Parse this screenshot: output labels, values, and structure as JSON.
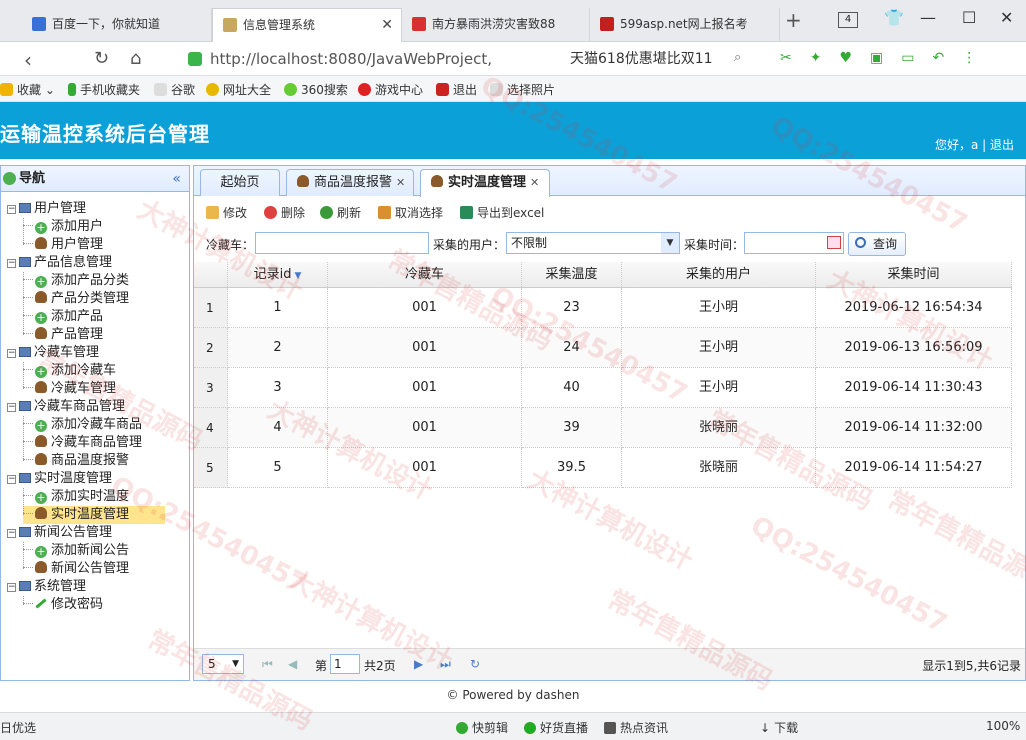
{
  "browser": {
    "tabs": [
      {
        "title": "百度一下，你就知道",
        "active": false
      },
      {
        "title": "信息管理系统",
        "active": true
      },
      {
        "title": "南方暴雨洪涝灾害致88",
        "active": false
      },
      {
        "title": "599asp.net网上报名考",
        "active": false
      }
    ],
    "tab_count": "4",
    "url": "http://localhost:8080/JavaWebProject,",
    "search_text": "天猫618优惠堪比双11",
    "bookmarks": [
      "收藏",
      "手机收藏夹",
      "谷歌",
      "网址大全",
      "360搜索",
      "游戏中心",
      "退出",
      "选择照片"
    ]
  },
  "app": {
    "title": "运输温控系统后台管理",
    "welcome": "您好，a",
    "logout": "退出"
  },
  "nav": {
    "title": "导航",
    "groups": [
      {
        "label": "用户管理",
        "items": [
          "添加用户",
          "用户管理"
        ]
      },
      {
        "label": "产品信息管理",
        "items": [
          "添加产品分类",
          "产品分类管理",
          "添加产品",
          "产品管理"
        ]
      },
      {
        "label": "冷藏车管理",
        "items": [
          "添加冷藏车",
          "冷藏车管理"
        ]
      },
      {
        "label": "冷藏车商品管理",
        "items": [
          "添加冷藏车商品",
          "冷藏车商品管理",
          "商品温度报警"
        ]
      },
      {
        "label": "实时温度管理",
        "items": [
          "添加实时温度",
          "实时温度管理"
        ]
      },
      {
        "label": "新闻公告管理",
        "items": [
          "添加新闻公告",
          "新闻公告管理"
        ]
      },
      {
        "label": "系统管理",
        "items": [
          "修改密码"
        ]
      }
    ],
    "selected": "实时温度管理"
  },
  "content_tabs": [
    {
      "label": "起始页",
      "closable": false
    },
    {
      "label": "商品温度报警",
      "closable": true
    },
    {
      "label": "实时温度管理",
      "closable": true,
      "active": true
    }
  ],
  "toolbar": {
    "edit": "修改",
    "delete": "删除",
    "refresh": "刷新",
    "cancel_select": "取消选择",
    "export": "导出到excel"
  },
  "filter": {
    "truck_label": "冷藏车：",
    "truck_value": "",
    "user_label": "采集的用户：",
    "user_value": "不限制",
    "time_label": "采集时间：",
    "time_value": "",
    "query": "查询"
  },
  "table": {
    "headers": [
      "记录id",
      "冷藏车",
      "采集温度",
      "采集的用户",
      "采集时间"
    ],
    "rows": [
      {
        "rn": "1",
        "id": "1",
        "truck": "001",
        "temp": "23",
        "user": "王小明",
        "time": "2019-06-12 16:54:34"
      },
      {
        "rn": "2",
        "id": "2",
        "truck": "001",
        "temp": "24",
        "user": "王小明",
        "time": "2019-06-13 16:56:09"
      },
      {
        "rn": "3",
        "id": "3",
        "truck": "001",
        "temp": "40",
        "user": "王小明",
        "time": "2019-06-14 11:30:43"
      },
      {
        "rn": "4",
        "id": "4",
        "truck": "001",
        "temp": "39",
        "user": "张晓丽",
        "time": "2019-06-14 11:32:00"
      },
      {
        "rn": "5",
        "id": "5",
        "truck": "001",
        "temp": "39.5",
        "user": "张晓丽",
        "time": "2019-06-14 11:54:27"
      }
    ]
  },
  "pager": {
    "page_size": "5",
    "page_prefix": "第",
    "page_value": "1",
    "page_total": "共2页",
    "info": "显示1到5,共6记录"
  },
  "footer": "© Powered by dashen",
  "statusbar": {
    "left": "日优选",
    "items": [
      "快剪辑",
      "好货直播",
      "热点资讯",
      "下载"
    ],
    "zoom": "100%"
  },
  "watermark_texts": [
    "QQ:254540457",
    "大神计算机设计",
    "常年售精品源码"
  ]
}
